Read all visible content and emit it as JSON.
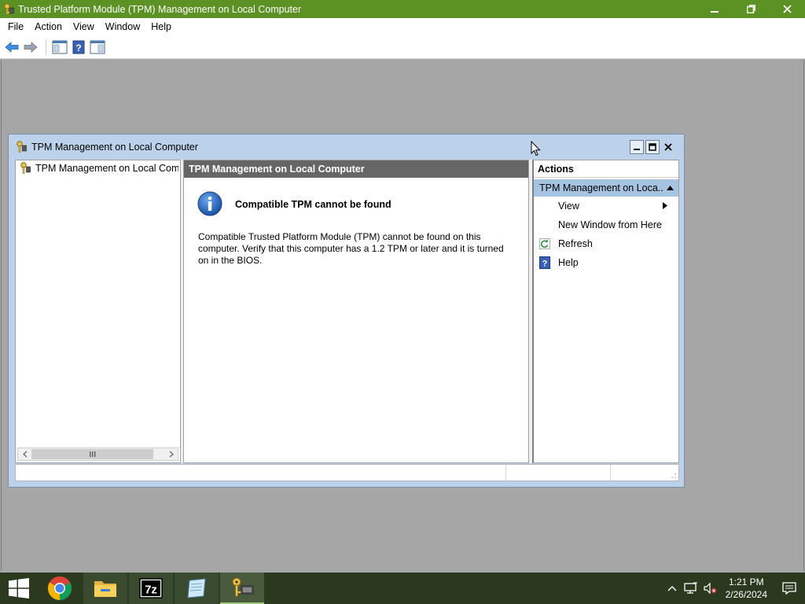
{
  "app": {
    "title": "Trusted Platform Module (TPM) Management on Local Computer",
    "minimize": "—",
    "restore": "❐",
    "close": "✕"
  },
  "menu": [
    "File",
    "Action",
    "View",
    "Window",
    "Help"
  ],
  "toolbar": {
    "icons": [
      "back-arrow-icon",
      "forward-arrow-icon",
      "show-hide-console-tree-icon",
      "help-icon",
      "show-hide-action-pane-icon"
    ]
  },
  "child_window": {
    "title": "TPM Management on Local Computer",
    "minimize": "▁",
    "maximize": "□",
    "close": "✕"
  },
  "tree": {
    "item_label": "TPM Management on Local Comp"
  },
  "result": {
    "header": "TPM Management on Local Computer",
    "heading": "Compatible TPM cannot be found",
    "body": "Compatible Trusted Platform Module (TPM) cannot be found on this computer. Verify that this computer has a 1.2 TPM or later and it is turned on in the BIOS."
  },
  "actions": {
    "header": "Actions",
    "section_label": "TPM Management on Loca...",
    "items": [
      {
        "label": "View",
        "icon": "",
        "has_submenu": true
      },
      {
        "label": "New Window from Here",
        "icon": "",
        "has_submenu": false
      },
      {
        "label": "Refresh",
        "icon": "refresh-icon",
        "has_submenu": false
      },
      {
        "label": "Help",
        "icon": "help-icon",
        "has_submenu": false
      }
    ]
  },
  "taskbar": {
    "apps": [
      "chrome-icon",
      "file-explorer-icon",
      "7zip-icon",
      "notepad-icon",
      "tpm-icon"
    ],
    "time": "1:21 PM",
    "date": "2/26/2024"
  },
  "colors": {
    "app_titlebar": "#5c9224",
    "child_titlebar": "#bcd2ea",
    "actions_section": "#a7c3e2",
    "taskbar": "#2b3a1f"
  }
}
